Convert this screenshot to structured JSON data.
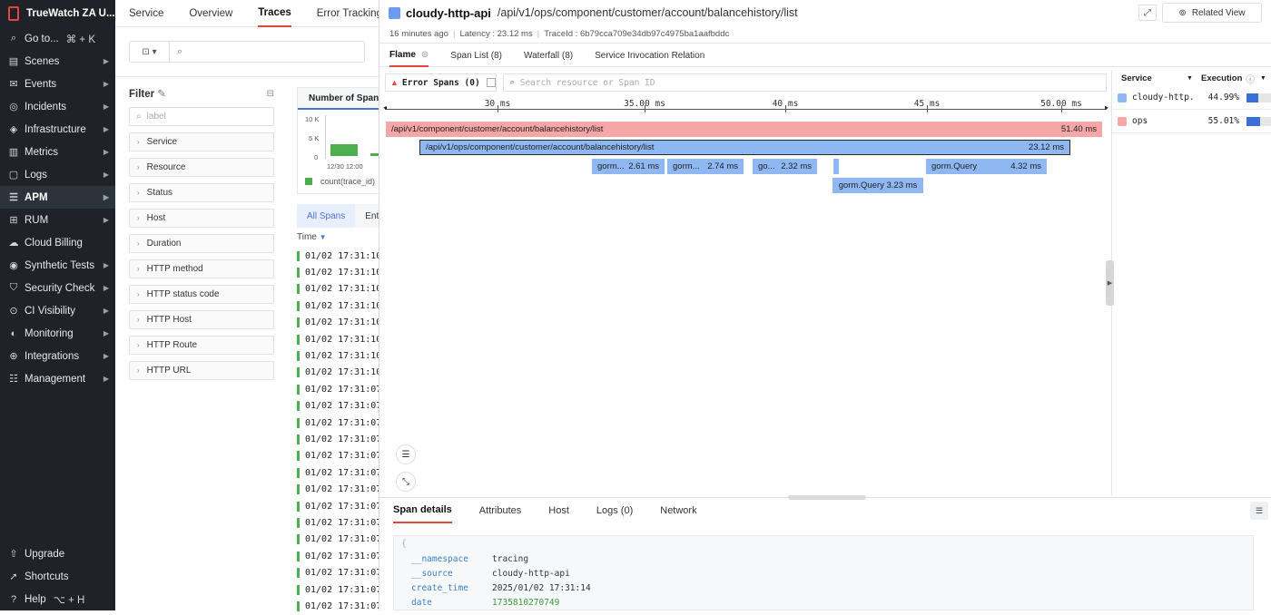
{
  "sidebar": {
    "brand": "TrueWatch ZA U...",
    "items": [
      {
        "label": "Go to...",
        "shortcut": "⌘ + K",
        "icon": "search-icon"
      },
      {
        "label": "Scenes",
        "icon": "scenes-icon"
      },
      {
        "label": "Events",
        "icon": "events-icon"
      },
      {
        "label": "Incidents",
        "icon": "incidents-icon"
      },
      {
        "label": "Infrastructure",
        "icon": "infrastructure-icon"
      },
      {
        "label": "Metrics",
        "icon": "metrics-icon"
      },
      {
        "label": "Logs",
        "icon": "logs-icon"
      },
      {
        "label": "APM",
        "icon": "apm-icon"
      },
      {
        "label": "RUM",
        "icon": "rum-icon"
      },
      {
        "label": "Cloud Billing",
        "icon": "cloud-icon"
      },
      {
        "label": "Synthetic Tests",
        "icon": "synthetic-icon"
      },
      {
        "label": "Security Check",
        "icon": "shield-icon"
      },
      {
        "label": "CI Visibility",
        "icon": "ci-icon"
      },
      {
        "label": "Monitoring",
        "icon": "monitoring-icon"
      },
      {
        "label": "Integrations",
        "icon": "integrations-icon"
      },
      {
        "label": "Management",
        "icon": "management-icon"
      }
    ],
    "bottom": [
      {
        "label": "Upgrade",
        "icon": "upgrade-icon"
      },
      {
        "label": "Shortcuts",
        "icon": "shortcuts-icon"
      },
      {
        "label": "Help",
        "shortcut": "⌥ + H",
        "icon": "help-icon"
      }
    ]
  },
  "apm": {
    "tabs": [
      "Service",
      "Overview",
      "Traces",
      "Error Tracking"
    ],
    "filter_title": "Filter",
    "filter_placeholder": "label",
    "facets": [
      "Service",
      "Resource",
      "Status",
      "Host",
      "Duration",
      "HTTP method",
      "HTTP status code",
      "HTTP Host",
      "HTTP Route",
      "HTTP URL"
    ],
    "chart_tab": "Number of Span",
    "chart_yticks": [
      "10 K",
      "5 K",
      "0"
    ],
    "chart_xtick": "12/30 12:00",
    "chart_legend": "count(trace_id)",
    "span_tabs": [
      "All Spans",
      "Ent"
    ],
    "time_header": "Time",
    "rows": [
      "01/02 17:31:10.",
      "01/02 17:31:10.",
      "01/02 17:31:10.",
      "01/02 17:31:10.",
      "01/02 17:31:10.",
      "01/02 17:31:10.",
      "01/02 17:31:10.",
      "01/02 17:31:10.",
      "01/02 17:31:07.",
      "01/02 17:31:07.",
      "01/02 17:31:07.",
      "01/02 17:31:07.",
      "01/02 17:31:07.",
      "01/02 17:31:07.",
      "01/02 17:31:07.",
      "01/02 17:31:07.",
      "01/02 17:31:07.",
      "01/02 17:31:07.",
      "01/02 17:31:07.",
      "01/02 17:31:07.",
      "01/02 17:31:07.",
      "01/02 17:31:07."
    ]
  },
  "panel": {
    "service": "cloudy-http-api",
    "resource": "/api/v1/ops/component/customer/account/balancehistory/list",
    "related_view": "Related View",
    "time_ago": "16 minutes ago",
    "latency": "Latency : 23.12 ms",
    "trace_id": "TraceId : 6b79cca709e34db97c4975ba1aafbddc",
    "tabs": [
      "Flame",
      "Span List (8)",
      "Waterfall (8)",
      "Service Invocation Relation"
    ],
    "error_spans": "Error Spans (0)",
    "search_placeholder": "Search resource or Span ID",
    "axis_ticks": [
      "30 ms",
      "35.00 ms",
      "40 ms",
      "45 ms",
      "50.00 ms"
    ],
    "spans": [
      {
        "label": "/api/v1/component/customer/account/balancehistory/list",
        "duration": "51.40 ms"
      },
      {
        "label": "/api/v1/ops/component/customer/account/balancehistory/list",
        "duration": "23.12 ms"
      },
      {
        "label": "gorm...",
        "duration": "2.61 ms"
      },
      {
        "label": "gorm...",
        "duration": "2.74 ms"
      },
      {
        "label": "go...",
        "duration": "2.32 ms"
      },
      {
        "label": "gorm.Query",
        "duration": "4.32 ms"
      },
      {
        "label": "gorm.Query",
        "duration": "3.23 ms"
      }
    ],
    "service_table": {
      "headers": [
        "Service",
        "Execution"
      ],
      "rows": [
        {
          "name": "cloudy-http...",
          "pct": "44.99%",
          "fraction": 0.4499,
          "color": "#8fb8f2"
        },
        {
          "name": "ops",
          "pct": "55.01%",
          "fraction": 0.5501,
          "color": "#f5a6a6"
        }
      ]
    },
    "detail_tabs": [
      "Span details",
      "Attributes",
      "Host",
      "Logs (0)",
      "Network"
    ],
    "json_brace": "{",
    "json": [
      {
        "key": "__namespace",
        "value": "tracing"
      },
      {
        "key": "__source",
        "value": "cloudy-http-api"
      },
      {
        "key": "create_time",
        "value": "2025/01/02 17:31:14"
      },
      {
        "key": "date",
        "value": "1735810270749"
      }
    ]
  },
  "colors": {
    "accent": "#e5453b",
    "span_red": "#f5a6a6",
    "span_blue": "#8fb8f2",
    "sidebar": "#1f2329"
  }
}
